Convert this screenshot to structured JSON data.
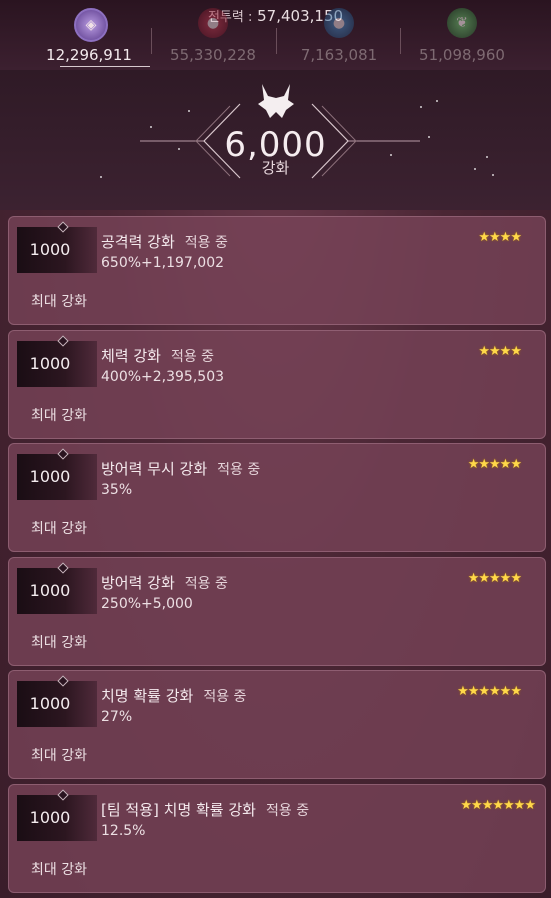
{
  "header": {
    "power_label": "전투력 :",
    "power_value": "57,403,150"
  },
  "currencies": [
    {
      "value": "12,296,911",
      "icon": "purple-gem-icon",
      "color": "#9b7bd1",
      "active": true
    },
    {
      "value": "55,330,228",
      "icon": "red-gem-icon",
      "color": "#b0283e",
      "active": false
    },
    {
      "value": "7,163,081",
      "icon": "blue-gem-icon",
      "color": "#3a7fb8",
      "active": false
    },
    {
      "value": "51,098,960",
      "icon": "green-gem-icon",
      "color": "#4ea15a",
      "active": false
    }
  ],
  "enhance": {
    "icon": "dragon-crest-icon",
    "level": "6,000",
    "label": "강화"
  },
  "cards": [
    {
      "level": "1000",
      "name": "공격력 강화",
      "status": "적용 중",
      "stat": "650%+1,197,002",
      "stars": "★★★★",
      "max": "최대 강화"
    },
    {
      "level": "1000",
      "name": "체력 강화",
      "status": "적용 중",
      "stat": "400%+2,395,503",
      "stars": "★★★★",
      "max": "최대 강화"
    },
    {
      "level": "1000",
      "name": "방어력 무시 강화",
      "status": "적용 중",
      "stat": "35%",
      "stars": "★★★★★",
      "max": "최대 강화"
    },
    {
      "level": "1000",
      "name": "방어력 강화",
      "status": "적용 중",
      "stat": "250%+5,000",
      "stars": "★★★★★",
      "max": "최대 강화"
    },
    {
      "level": "1000",
      "name": "치명 확률 강화",
      "status": "적용 중",
      "stat": "27%",
      "stars": "★★★★★★",
      "max": "최대 강화"
    },
    {
      "level": "1000",
      "name": "[팀 적용] 치명 확률 강화",
      "status": "적용 중",
      "stat": "12.5%",
      "stars": "★★★★★★★",
      "max": "최대 강화"
    }
  ]
}
